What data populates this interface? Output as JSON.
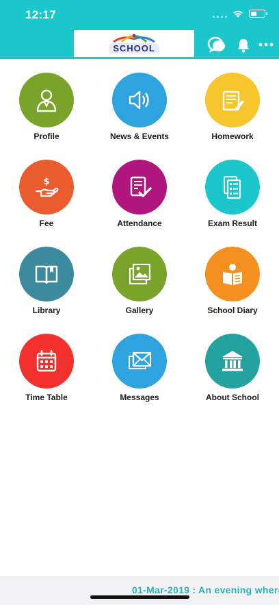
{
  "status_bar": {
    "time": "12:17"
  },
  "header": {
    "logo_text": "SCHOOL",
    "icons": [
      "chat-bubbles-icon",
      "bell-icon",
      "more-icon"
    ]
  },
  "menu": [
    {
      "label": "Profile",
      "color": "#79a32a",
      "icon": "person-icon"
    },
    {
      "label": "News & Events",
      "color": "#2fa3dd",
      "icon": "speaker-icon"
    },
    {
      "label": "Homework",
      "color": "#f7c52c",
      "icon": "notepad-pencil-icon"
    },
    {
      "label": "Fee",
      "color": "#ea5b2e",
      "icon": "hand-money-icon"
    },
    {
      "label": "Attendance",
      "color": "#b0167e",
      "icon": "checklist-icon"
    },
    {
      "label": "Exam Result",
      "color": "#1cc7cc",
      "icon": "report-icon"
    },
    {
      "label": "Library",
      "color": "#3b8a9d",
      "icon": "book-icon"
    },
    {
      "label": "Gallery",
      "color": "#79a32a",
      "icon": "photos-icon"
    },
    {
      "label": "School Diary",
      "color": "#f4901f",
      "icon": "reader-icon"
    },
    {
      "label": "Time Table",
      "color": "#f2302d",
      "icon": "calendar-icon"
    },
    {
      "label": "Messages",
      "color": "#2fa3dd",
      "icon": "envelopes-icon"
    },
    {
      "label": "About School",
      "color": "#23a2a0",
      "icon": "bank-icon"
    }
  ],
  "ticker": {
    "text": "01-Mar-2019 : An evening where"
  }
}
